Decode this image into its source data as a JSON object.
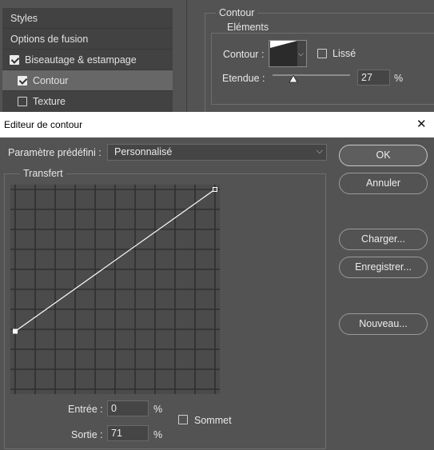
{
  "background_panel": {
    "list_items": [
      {
        "label": "Styles",
        "checkbox": false,
        "checked": false,
        "selected": false
      },
      {
        "label": "Options de fusion",
        "checkbox": false,
        "checked": false,
        "selected": false
      },
      {
        "label": "Biseautage & estampage",
        "checkbox": true,
        "checked": true,
        "selected": false
      },
      {
        "label": "Contour",
        "checkbox": true,
        "checked": true,
        "selected": true
      },
      {
        "label": "Texture",
        "checkbox": true,
        "checked": false,
        "selected": false
      }
    ],
    "contour_section": {
      "title": "Contour",
      "group_title": "Eléments",
      "contour_label": "Contour :",
      "lisse_label": "Lissé",
      "lisse_checked": false,
      "etendue_label": "Etendue :",
      "etendue_value": "27",
      "etendue_unit": "%",
      "etendue_fraction": 0.27
    }
  },
  "dialog": {
    "title": "Editeur de contour",
    "close_glyph": "✕",
    "preset_label": "Paramètre prédéfini :",
    "preset_value": "Personnalisé",
    "transfer_title": "Transfert",
    "curve_points": [
      {
        "input": 0,
        "output": 29
      },
      {
        "input": 100,
        "output": 100
      }
    ],
    "input_label": "Entrée :",
    "input_value": "0",
    "output_label": "Sortie :",
    "output_value": "71",
    "percent": "%",
    "sommet_label": "Sommet",
    "sommet_checked": false,
    "buttons": {
      "ok": "OK",
      "cancel": "Annuler",
      "load": "Charger...",
      "save": "Enregistrer...",
      "new": "Nouveau..."
    }
  }
}
